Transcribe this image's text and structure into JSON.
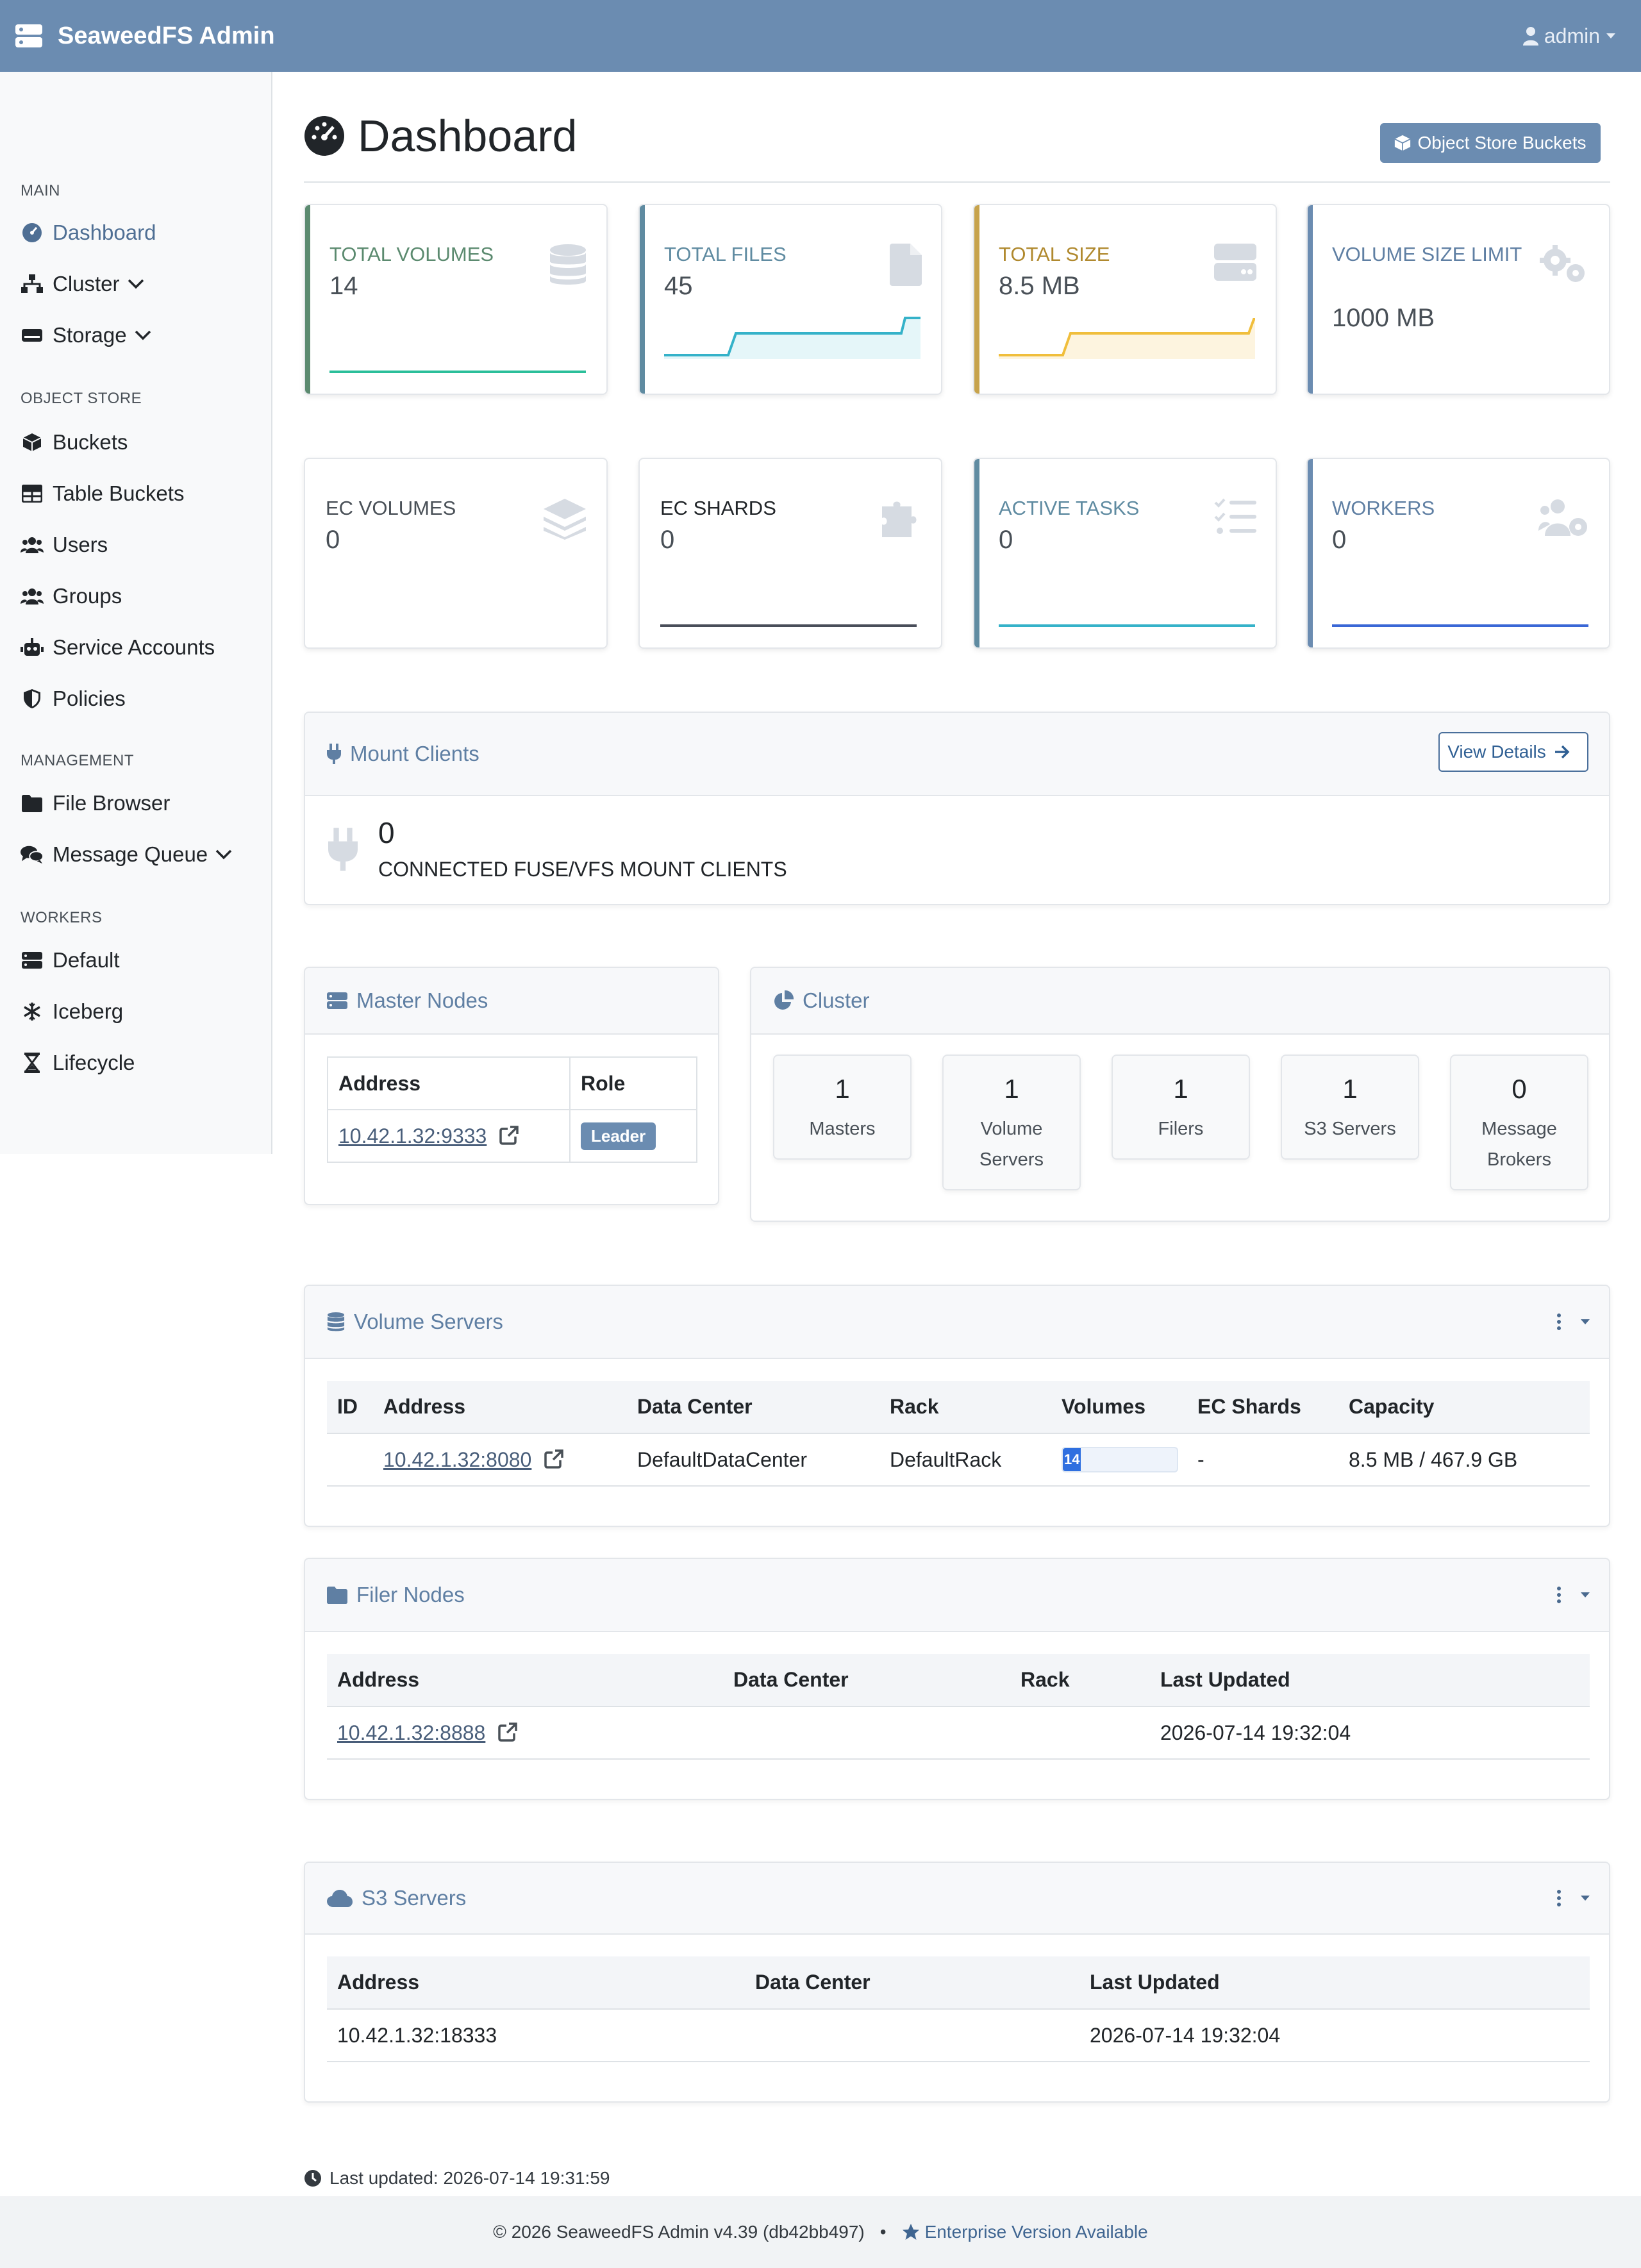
{
  "app": {
    "brand": "SeaweedFS Admin",
    "user": "admin"
  },
  "sidebar": {
    "sections": {
      "main": "MAIN",
      "object_store": "OBJECT STORE",
      "management": "MANAGEMENT",
      "workers": "WORKERS"
    },
    "items": {
      "dashboard": "Dashboard",
      "cluster": "Cluster",
      "storage": "Storage",
      "buckets": "Buckets",
      "table_buckets": "Table Buckets",
      "users": "Users",
      "groups": "Groups",
      "service_accounts": "Service Accounts",
      "policies": "Policies",
      "file_browser": "File Browser",
      "message_queue": "Message Queue",
      "default": "Default",
      "iceberg": "Iceberg",
      "lifecycle": "Lifecycle"
    }
  },
  "page": {
    "title": "Dashboard",
    "object_store_button": "Object Store Buckets"
  },
  "stats": {
    "total_volumes": {
      "label": "TOTAL VOLUMES",
      "value": "14",
      "color": "#5b8a6f",
      "spark_color": "#2bbf9a"
    },
    "total_files": {
      "label": "TOTAL FILES",
      "value": "45",
      "color": "#5f8ba1",
      "spark_color": "#35b2c9"
    },
    "total_size": {
      "label": "TOTAL SIZE",
      "value": "8.5 MB",
      "color": "#c7a34c",
      "spark_color": "#f0be3c"
    },
    "volume_size_limit": {
      "label": "VOLUME SIZE LIMIT",
      "value": "1000 MB",
      "color": "#6b8cb1"
    },
    "ec_volumes": {
      "label": "EC VOLUMES",
      "value": "0",
      "color": "#495057"
    },
    "ec_shards": {
      "label": "EC SHARDS",
      "value": "0",
      "color": "#212529",
      "spark_color": "#494e59"
    },
    "active_tasks": {
      "label": "ACTIVE TASKS",
      "value": "0",
      "color": "#5f8ba1",
      "spark_color": "#35b2c9"
    },
    "workers": {
      "label": "WORKERS",
      "value": "0",
      "color": "#6b8cb1",
      "spark_color": "#3a67d6"
    }
  },
  "mount_clients": {
    "title": "Mount Clients",
    "view_details": "View Details",
    "count": "0",
    "label": "CONNECTED FUSE/VFS MOUNT CLIENTS"
  },
  "master_nodes": {
    "title": "Master Nodes",
    "headers": [
      "Address",
      "Role"
    ],
    "rows": [
      {
        "address": "10.42.1.32:9333",
        "role": "Leader"
      }
    ]
  },
  "cluster": {
    "title": "Cluster",
    "items": [
      {
        "count": "1",
        "label": "Masters"
      },
      {
        "count": "1",
        "label": "Volume Servers"
      },
      {
        "count": "1",
        "label": "Filers"
      },
      {
        "count": "1",
        "label": "S3 Servers"
      },
      {
        "count": "0",
        "label": "Message Brokers"
      }
    ]
  },
  "volume_servers": {
    "title": "Volume Servers",
    "headers": [
      "ID",
      "Address",
      "Data Center",
      "Rack",
      "Volumes",
      "EC Shards",
      "Capacity"
    ],
    "rows": [
      {
        "id": "",
        "address": "10.42.1.32:8080",
        "data_center": "DefaultDataCenter",
        "rack": "DefaultRack",
        "volumes": "14",
        "volumes_fraction": 0.014,
        "ec_shards": "-",
        "capacity": "8.5 MB / 467.9 GB"
      }
    ]
  },
  "filer_nodes": {
    "title": "Filer Nodes",
    "headers": [
      "Address",
      "Data Center",
      "Rack",
      "Last Updated"
    ],
    "rows": [
      {
        "address": "10.42.1.32:8888",
        "data_center": "",
        "rack": "",
        "last_updated": "2026-07-14 19:32:04"
      }
    ]
  },
  "s3_servers": {
    "title": "S3 Servers",
    "headers": [
      "Address",
      "Data Center",
      "Last Updated"
    ],
    "rows": [
      {
        "address": "10.42.1.32:18333",
        "data_center": "",
        "last_updated": "2026-07-14 19:32:04"
      }
    ]
  },
  "footer": {
    "last_updated": "Last updated: 2026-07-14 19:31:59",
    "copyright": "© 2026 SeaweedFS Admin v4.39  (db42bb497)",
    "separator": "•",
    "enterprise": "Enterprise Version Available"
  }
}
